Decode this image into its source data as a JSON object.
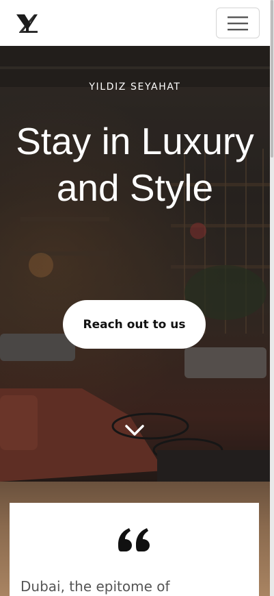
{
  "header": {
    "logo_icon": "yz-monogram-logo",
    "menu_icon": "hamburger-menu-icon"
  },
  "hero": {
    "kicker": "YILDIZ SEYAHAT",
    "title": "Stay in Luxury and Style",
    "cta_label": "Reach out to us",
    "scroll_icon": "chevron-down-icon"
  },
  "testimonial": {
    "quote_icon": "quote-icon",
    "text": "Dubai, the epitome of"
  }
}
